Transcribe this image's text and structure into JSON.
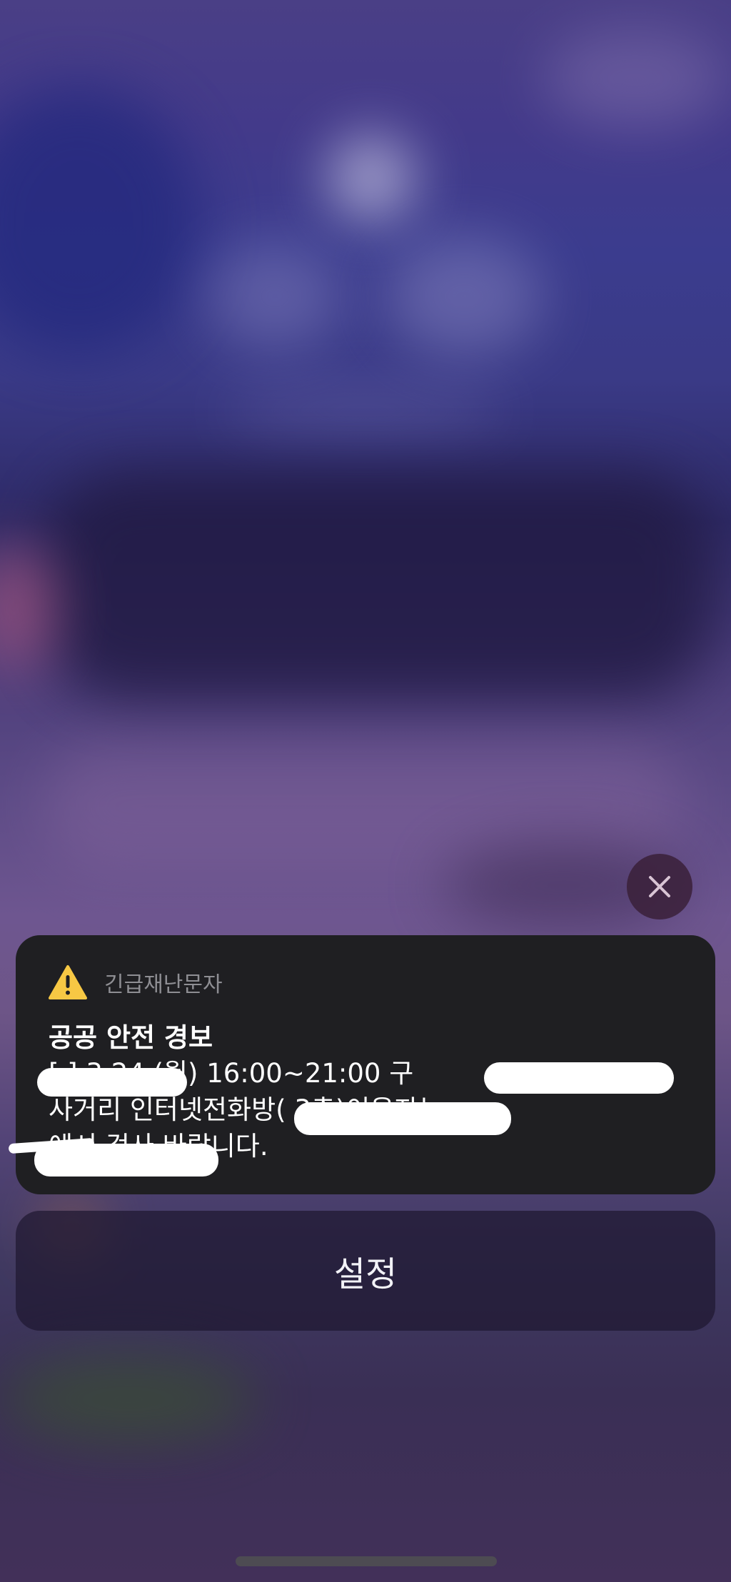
{
  "alert": {
    "source": "긴급재난문자",
    "title": "공공 안전 경보",
    "body": "[              ] 3.24.(월) 16:00~21:00              구\n사거리 인터넷전화방(                       3층)이용자는\n                   에서 검사 바랍니다.",
    "icon": "warning-triangle-icon"
  },
  "actions": {
    "settings_label": "설정",
    "close_icon": "close-icon"
  },
  "colors": {
    "card_background": "#1f1f22",
    "warning_yellow": "#f7c844",
    "source_gray": "#8e8e93"
  }
}
